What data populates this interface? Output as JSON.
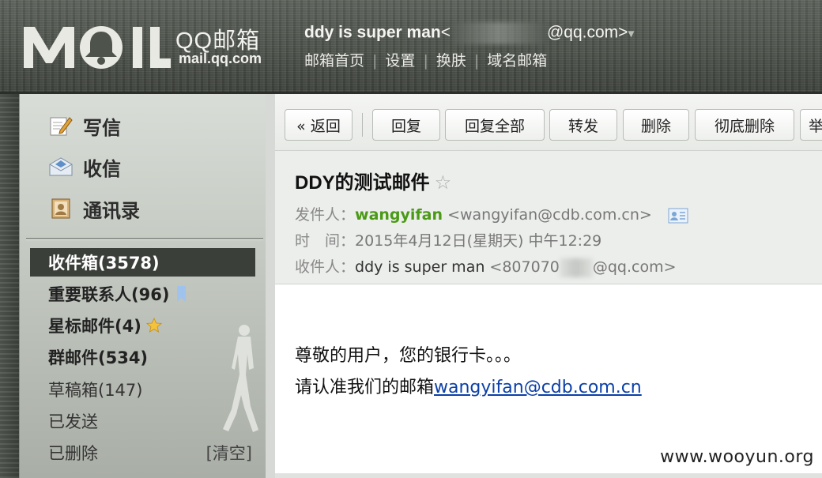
{
  "header": {
    "logo_brand": "QQ邮箱",
    "logo_domain": "mail.qq.com",
    "user_name": "ddy is super man",
    "user_email_prefix": "<",
    "user_email_suffix": "@qq.com>",
    "account_caret": "▾",
    "links": [
      "邮箱首页",
      "设置",
      "换肤",
      "域名邮箱"
    ],
    "link_separator": "|"
  },
  "sidebar": {
    "compose": "写信",
    "inbox_check": "收信",
    "contacts": "通讯录",
    "folders": [
      {
        "label": "收件箱(3578)"
      },
      {
        "label": "重要联系人(96)"
      },
      {
        "label": "星标邮件(4)"
      },
      {
        "label": "群邮件(534)"
      },
      {
        "label": "草稿箱(147)"
      },
      {
        "label": "已发送"
      },
      {
        "label": "已删除",
        "action": "[清空]"
      }
    ]
  },
  "toolbar": {
    "back": "« 返回",
    "reply": "回复",
    "reply_all": "回复全部",
    "forward": "转发",
    "delete": "删除",
    "delete_forever": "彻底删除",
    "overflow": "举"
  },
  "mail": {
    "subject": "DDY的测试邮件",
    "star": "☆",
    "from_label": "发件人：",
    "from_name": "wangyifan",
    "from_addr": "<wangyifan@cdb.com.cn>",
    "time_label": "时　间：",
    "time_value": "2015年4月12日(星期天) 中午12:29",
    "to_label": "收件人：",
    "to_name": "ddy is super man",
    "to_addr_prefix": "<807070",
    "to_addr_suffix": "@qq.com>",
    "body_line1": "尊敬的用户，您的银行卡。。。",
    "body_line2_text": "请认准我们的邮箱",
    "body_line2_link": "wangyifan@cdb.com.cn"
  },
  "watermark": "www.wooyun.org"
}
